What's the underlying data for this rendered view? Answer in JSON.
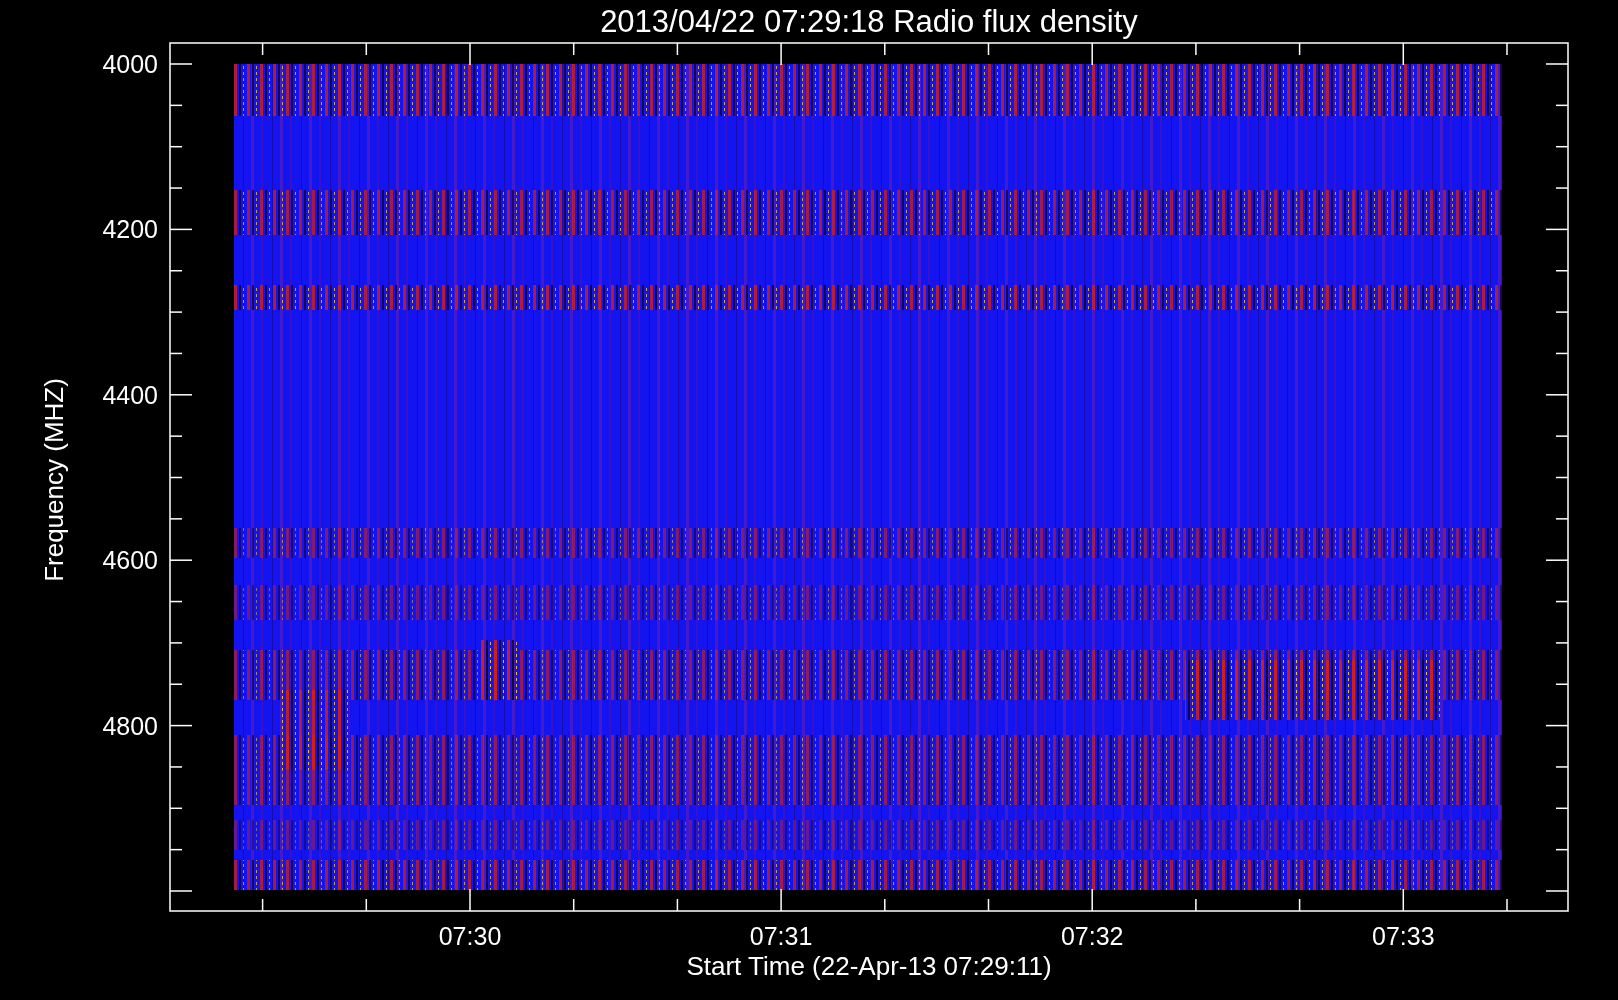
{
  "title": "2013/04/22 07:29:18 Radio flux density",
  "y_axis": {
    "label": "Frequency (MHZ)",
    "ticks": [
      "4000",
      "4200",
      "4400",
      "4600",
      "4800"
    ]
  },
  "x_axis": {
    "label": "Start Time (22-Apr-13 07:29:11)",
    "ticks": [
      "07:30",
      "07:31",
      "07:32",
      "07:33"
    ]
  }
}
